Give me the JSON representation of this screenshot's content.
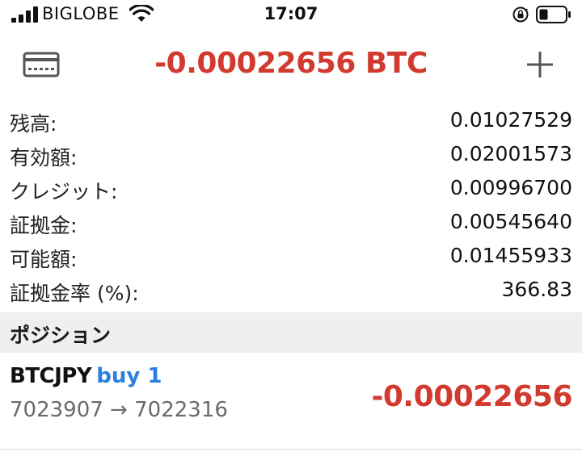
{
  "status_bar": {
    "carrier": "BIGLOBE",
    "time": "17:07",
    "icons": [
      "signal-icon",
      "wifi-icon",
      "orientation-lock-icon",
      "battery-icon"
    ]
  },
  "header": {
    "title": "-0.00022656 BTC",
    "title_color": "#d23a2f",
    "left_icon": "card-icon",
    "right_icon": "plus-icon"
  },
  "account": [
    {
      "label": "残高:",
      "value": "0.01027529"
    },
    {
      "label": "有効額:",
      "value": "0.02001573"
    },
    {
      "label": "クレジット:",
      "value": "0.00996700"
    },
    {
      "label": "証拠金:",
      "value": "0.00545640"
    },
    {
      "label": "可能額:",
      "value": "0.01455933"
    },
    {
      "label": "証拠金率 (%):",
      "value": "366.83"
    }
  ],
  "positions_section": {
    "title": "ポジション"
  },
  "position": {
    "symbol": "BTCJPY",
    "side": "buy 1",
    "prices": "7023907 → 7022316",
    "profit": "-0.00022656",
    "side_color": "#2a80e0",
    "profit_color": "#d23a2f"
  }
}
